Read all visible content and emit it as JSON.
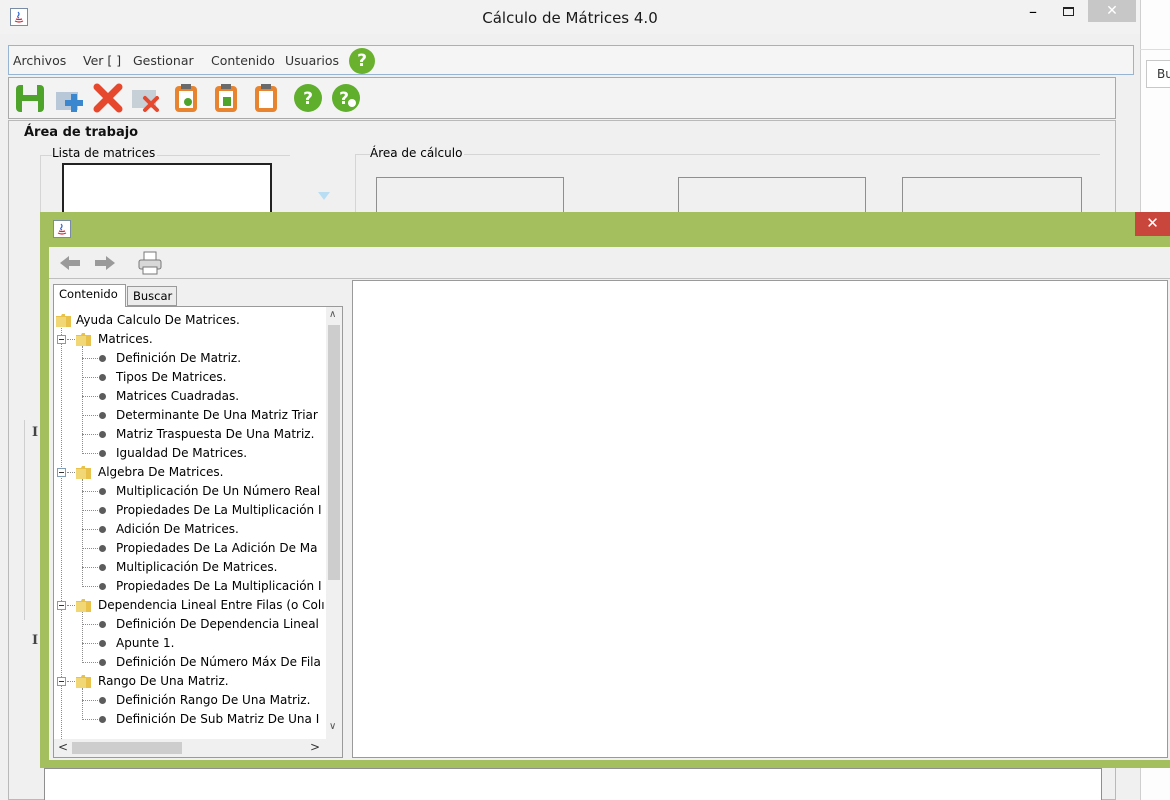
{
  "main_window": {
    "title": "Cálculo de Mátrices 4.0",
    "menu": [
      "Archivos",
      "Ver [ ]",
      "Gestionar",
      "Contenido",
      "Usuarios"
    ],
    "help_badge": "?",
    "toolbar_icons": [
      "save-icon",
      "add-icon",
      "delete-icon",
      "delete-doc-icon",
      "clipboard-settings-icon",
      "clipboard-save-icon",
      "clipboard-icon",
      "help-icon",
      "help-settings-icon"
    ],
    "workspace_title": "Área de trabajo",
    "lista_title": "Lista de matrices",
    "calc_title": "Área de cálculo",
    "side_marker": "I"
  },
  "right_strip": {
    "text": "Bu"
  },
  "help_window": {
    "close_label": "✕",
    "tabs": [
      "Contenido",
      "Buscar"
    ],
    "tree": [
      {
        "label": "Ayuda Calculo De Matrices.",
        "level": 0,
        "type": "folder"
      },
      {
        "label": "Matrices.",
        "level": 1,
        "type": "folder"
      },
      {
        "label": "Definición De Matriz.",
        "level": 2,
        "type": "leaf"
      },
      {
        "label": "Tipos De Matrices.",
        "level": 2,
        "type": "leaf"
      },
      {
        "label": "Matrices Cuadradas.",
        "level": 2,
        "type": "leaf"
      },
      {
        "label": "Determinante De Una Matriz Triar",
        "level": 2,
        "type": "leaf"
      },
      {
        "label": "Matriz Traspuesta De Una Matriz.",
        "level": 2,
        "type": "leaf"
      },
      {
        "label": "Igualdad De Matrices.",
        "level": 2,
        "type": "leaf"
      },
      {
        "label": "Algebra De Matrices.",
        "level": 1,
        "type": "folder"
      },
      {
        "label": "Multiplicación De Un Número Real",
        "level": 2,
        "type": "leaf"
      },
      {
        "label": "Propiedades De La Multiplicación I",
        "level": 2,
        "type": "leaf"
      },
      {
        "label": "Adición De Matrices.",
        "level": 2,
        "type": "leaf"
      },
      {
        "label": "Propiedades De La Adición De Ma",
        "level": 2,
        "type": "leaf"
      },
      {
        "label": "Multiplicación De Matrices.",
        "level": 2,
        "type": "leaf"
      },
      {
        "label": "Propiedades De La Multiplicación I",
        "level": 2,
        "type": "leaf"
      },
      {
        "label": "Dependencia Lineal Entre Filas (o Colı",
        "level": 1,
        "type": "folder"
      },
      {
        "label": "Definición De Dependencia Lineal",
        "level": 2,
        "type": "leaf"
      },
      {
        "label": "Apunte 1.",
        "level": 2,
        "type": "leaf"
      },
      {
        "label": "Definición De Número Máx De Fila",
        "level": 2,
        "type": "leaf"
      },
      {
        "label": "Rango De Una Matriz.",
        "level": 1,
        "type": "folder"
      },
      {
        "label": "Definición Rango De Una Matriz.",
        "level": 2,
        "type": "leaf"
      },
      {
        "label": "Definición De Sub Matriz De Una I",
        "level": 2,
        "type": "leaf"
      }
    ]
  }
}
